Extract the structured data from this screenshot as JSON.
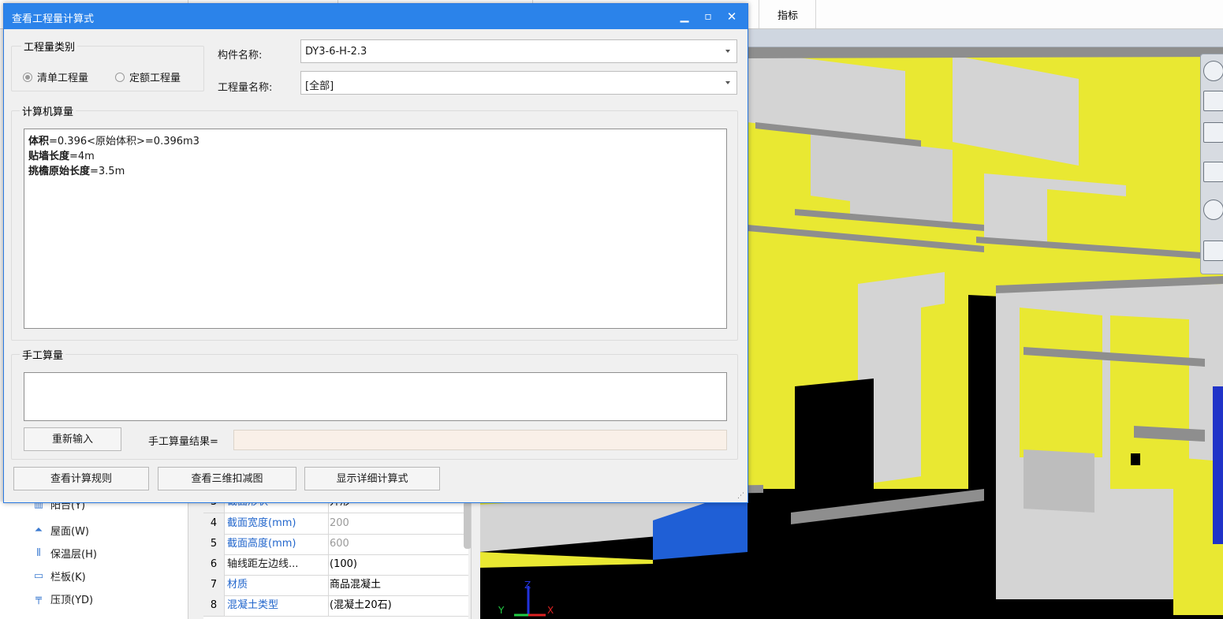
{
  "background": {
    "top_tab": "指标",
    "tree_items": [
      {
        "label": "阳台(Y)",
        "icon": "balcony-icon"
      },
      {
        "label": "屋面(W)",
        "icon": "roof-icon"
      },
      {
        "label": "保温层(H)",
        "icon": "insulation-icon"
      },
      {
        "label": "栏板(K)",
        "icon": "parapet-icon"
      },
      {
        "label": "压顶(YD)",
        "icon": "coping-icon"
      }
    ],
    "properties": [
      {
        "num": "3",
        "name": "截面形状",
        "value": "异形"
      },
      {
        "num": "4",
        "name": "截面宽度(mm)",
        "value": "200"
      },
      {
        "num": "5",
        "name": "截面高度(mm)",
        "value": "600"
      },
      {
        "num": "6",
        "name": "轴线距左边线...",
        "value": "(100)"
      },
      {
        "num": "7",
        "name": "材质",
        "value": "商品混凝土"
      },
      {
        "num": "8",
        "name": "混凝土类型",
        "value": "(混凝土20石)"
      }
    ],
    "axis_labels": {
      "z": "Z",
      "x": "X",
      "y": "Y"
    },
    "colors": {
      "wall_yellow": "#e9e832",
      "wall_gray": "#d4d4d4",
      "beam_blue": "#1f5fd6",
      "viewport_bg": "#000000"
    }
  },
  "dialog": {
    "title": "查看工程量计算式",
    "qty_type": {
      "label": "工程量类别",
      "options": [
        {
          "label": "清单工程量",
          "selected": true
        },
        {
          "label": "定额工程量",
          "selected": false
        }
      ]
    },
    "component_name": {
      "label": "构件名称:",
      "value": "DY3-6-H-2.3"
    },
    "quantity_name": {
      "label": "工程量名称:",
      "value": "[全部]"
    },
    "computer_calc": {
      "label": "计算机算量",
      "lines": [
        {
          "key": "体积",
          "rest": "=0.396<原始体积>=0.396m3"
        },
        {
          "key": "贴墙长度",
          "rest": "=4m"
        },
        {
          "key": "挑檐原始长度",
          "rest": "=3.5m"
        }
      ]
    },
    "manual_calc": {
      "label": "手工算量",
      "reenter_button": "重新输入",
      "result_label": "手工算量结果=",
      "result_value": ""
    },
    "buttons": {
      "view_rules": "查看计算规则",
      "view_3d": "查看三维扣减图",
      "show_detail": "显示详细计算式"
    },
    "title_colors": {
      "titlebar": "#2b83ea",
      "text": "#ffffff"
    }
  }
}
